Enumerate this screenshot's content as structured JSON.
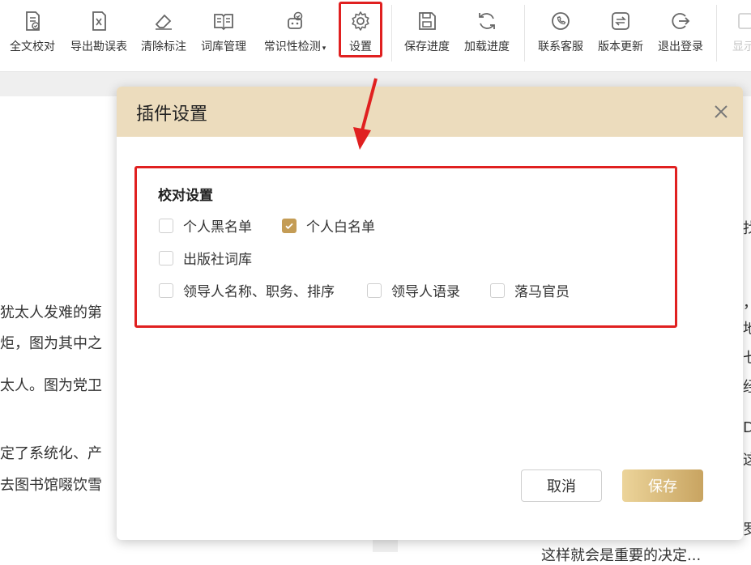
{
  "toolbar": {
    "items": [
      {
        "label": "全文校对",
        "icon": "proofread-doc-icon"
      },
      {
        "label": "导出勘误表",
        "icon": "export-excel-icon"
      },
      {
        "label": "清除标注",
        "icon": "eraser-icon"
      },
      {
        "label": "词库管理",
        "icon": "book-icon"
      },
      {
        "label": "常识性检测",
        "icon": "common-sense-check-icon",
        "caret": "▾"
      },
      {
        "label": "设置",
        "icon": "gear-icon"
      },
      {
        "label": "保存进度",
        "icon": "save-icon"
      },
      {
        "label": "加载进度",
        "icon": "reload-icon"
      },
      {
        "label": "联系客服",
        "icon": "phone-chat-icon"
      },
      {
        "label": "版本更新",
        "icon": "update-icon"
      },
      {
        "label": "退出登录",
        "icon": "logout-icon"
      },
      {
        "label": "显示",
        "icon": "display-icon"
      }
    ]
  },
  "document": {
    "left_lines": [
      "犹太人发难的第",
      "炬，图为其中之",
      "太人。图为党卫",
      "定了系统化、产",
      "去图书馆啜饮雪"
    ],
    "right_lines": [
      "找",
      "，",
      "地",
      "七",
      "经",
      "D",
      "这",
      "罗",
      "这样就会是重要的决定..."
    ]
  },
  "dialog": {
    "title": "插件设置",
    "section_title": "校对设置",
    "options": [
      {
        "label": "个人黑名单",
        "checked": false
      },
      {
        "label": "个人白名单",
        "checked": true
      },
      {
        "label": "出版社词库",
        "checked": false
      },
      {
        "label": "领导人名称、职务、排序",
        "checked": false
      },
      {
        "label": "领导人语录",
        "checked": false
      },
      {
        "label": "落马官员",
        "checked": false
      }
    ],
    "cancel_label": "取消",
    "save_label": "保存"
  },
  "colors": {
    "dialog_header": "#ecdcbd",
    "accent": "#c49c55",
    "highlight": "#e02020"
  }
}
